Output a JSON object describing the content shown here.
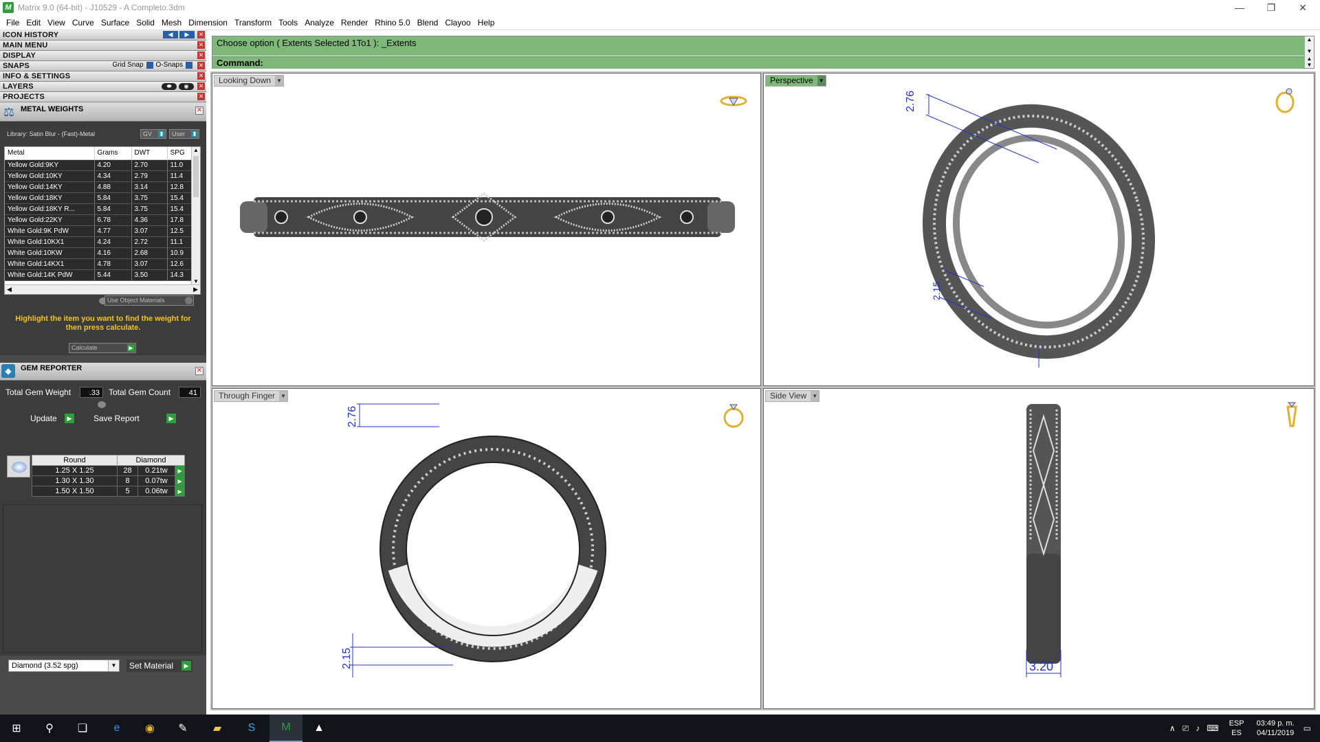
{
  "window": {
    "title": "Matrix 9.0 (64-bit) - J10529 - A Completo.3dm",
    "app_icon": "matrix-icon",
    "minimize": "—",
    "maximize": "❐",
    "close": "✕"
  },
  "menu": [
    "File",
    "Edit",
    "View",
    "Curve",
    "Surface",
    "Solid",
    "Mesh",
    "Dimension",
    "Transform",
    "Tools",
    "Analyze",
    "Render",
    "Rhino 5.0",
    "Blend",
    "Clayoo",
    "Help"
  ],
  "stack": {
    "icon_history": "ICON HISTORY",
    "main_menu": "MAIN MENU",
    "display": "DISPLAY",
    "snaps": "SNAPS",
    "grid_snap": "Grid Snap",
    "o_snaps": "O-Snaps",
    "info_settings": "INFO & SETTINGS",
    "layers": "LAYERS",
    "projects": "PROJECTS"
  },
  "metal_weights": {
    "title": "METAL WEIGHTS",
    "library": "Library: Satin Blur - (Fast)-Metal",
    "gv_label": "GV",
    "user_label": "User",
    "columns": [
      "Metal",
      "Grams",
      "DWT",
      "SPG"
    ],
    "rows": [
      [
        "Yellow Gold:9KY",
        "4.20",
        "2.70",
        "11.0"
      ],
      [
        "Yellow Gold:10KY",
        "4.34",
        "2.79",
        "11.4"
      ],
      [
        "Yellow Gold:14KY",
        "4.88",
        "3.14",
        "12.8"
      ],
      [
        "Yellow Gold:18KY",
        "5.84",
        "3.75",
        "15.4"
      ],
      [
        "Yellow Gold:18KY R...",
        "5.84",
        "3.75",
        "15.4"
      ],
      [
        "Yellow Gold:22KY",
        "6.78",
        "4.36",
        "17.8"
      ],
      [
        "White Gold:9K PdW",
        "4.77",
        "3.07",
        "12.5"
      ],
      [
        "White Gold:10KX1",
        "4.24",
        "2.72",
        "11.1"
      ],
      [
        "White Gold:10KW",
        "4.16",
        "2.68",
        "10.9"
      ],
      [
        "White Gold:14KX1",
        "4.78",
        "3.07",
        "12.6"
      ],
      [
        "White Gold:14K PdW",
        "5.44",
        "3.50",
        "14.3"
      ]
    ],
    "use_object_materials": "Use Object Materials",
    "hint": "Highlight the item you want to find the weight for then press calculate.",
    "calculate": "Calculate"
  },
  "gem_reporter": {
    "title": "GEM REPORTER",
    "total_weight_label": "Total Gem Weight",
    "total_weight": ".33",
    "total_count_label": "Total Gem Count",
    "total_count": "41",
    "update": "Update",
    "save_report": "Save Report",
    "shape_header": "Round",
    "material_header": "Diamond",
    "rows": [
      [
        "1.25 X 1.25",
        "28",
        "0.21tw"
      ],
      [
        "1.30 X 1.30",
        "8",
        "0.07tw"
      ],
      [
        "1.50 X 1.50",
        "5",
        "0.06tw"
      ]
    ],
    "material_select": "Diamond    (3.52 spg)",
    "set_material": "Set Material"
  },
  "command": {
    "history": "Choose option ( Extents  Selected  1To1 ): _Extents",
    "prompt": "Command:"
  },
  "viewports": {
    "top": "Looking Down",
    "perspective": "Perspective",
    "front": "Through Finger",
    "side": "Side View"
  },
  "dimensions": {
    "persp_top": "2.76",
    "persp_bottom": "2.15",
    "front_top": "2.76",
    "front_bottom": "2.15",
    "side_width": "3.20"
  },
  "taskbar": {
    "language_top": "ESP",
    "language_bottom": "ES",
    "time": "03:49 p. m.",
    "date": "04/11/2019"
  },
  "colors": {
    "command_bg": "#7fb97a",
    "panel_bg": "#3c3c3c",
    "hint": "#f0c419",
    "go_button": "#2e9e3c",
    "dimension": "#2233cc"
  }
}
